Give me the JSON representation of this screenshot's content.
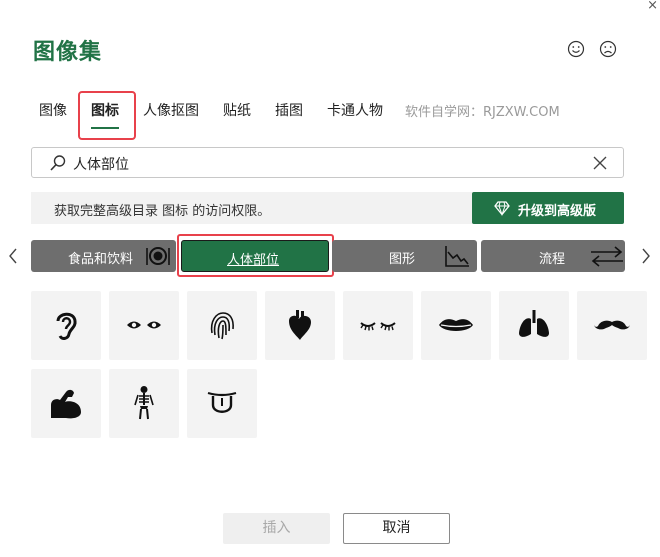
{
  "dialog": {
    "title": "图像集",
    "close_glyph": "×",
    "feedback": {
      "smile_icon": "smile-icon",
      "frown_icon": "frown-icon"
    }
  },
  "tabs": [
    {
      "label": "图像",
      "active": false
    },
    {
      "label": "图标",
      "active": true
    },
    {
      "label": "人像抠图",
      "active": false
    },
    {
      "label": "贴纸",
      "active": false
    },
    {
      "label": "插图",
      "active": false
    },
    {
      "label": "卡通人物",
      "active": false
    }
  ],
  "watermark": "软件自学网：RJZXW.COM",
  "search": {
    "value": "人体部位",
    "icon": "search-icon",
    "clear_icon": "close-icon"
  },
  "premium": {
    "message": "获取完整高级目录 图标 的访问权限。",
    "upgrade_label": "升级到高级版",
    "upgrade_icon": "diamond-icon"
  },
  "categories": [
    {
      "label": "食品和饮料",
      "icon": "plate-icon",
      "active": false
    },
    {
      "label": "人体部位",
      "icon": "",
      "active": true
    },
    {
      "label": "图形",
      "icon": "chart-icon",
      "active": false
    },
    {
      "label": "流程",
      "icon": "arrows-icon",
      "active": false
    }
  ],
  "icons": [
    "ear-icon",
    "eyes-icon",
    "fingerprint-icon",
    "heart-organ-icon",
    "eyelashes-icon",
    "lips-icon",
    "lungs-icon",
    "mustache-icon",
    "bicep-icon",
    "skeleton-icon",
    "tongue-icon"
  ],
  "footer": {
    "insert_label": "插入",
    "cancel_label": "取消"
  },
  "colors": {
    "accent": "#217346",
    "highlight": "#e8414b",
    "category": "#6e6e6e"
  }
}
